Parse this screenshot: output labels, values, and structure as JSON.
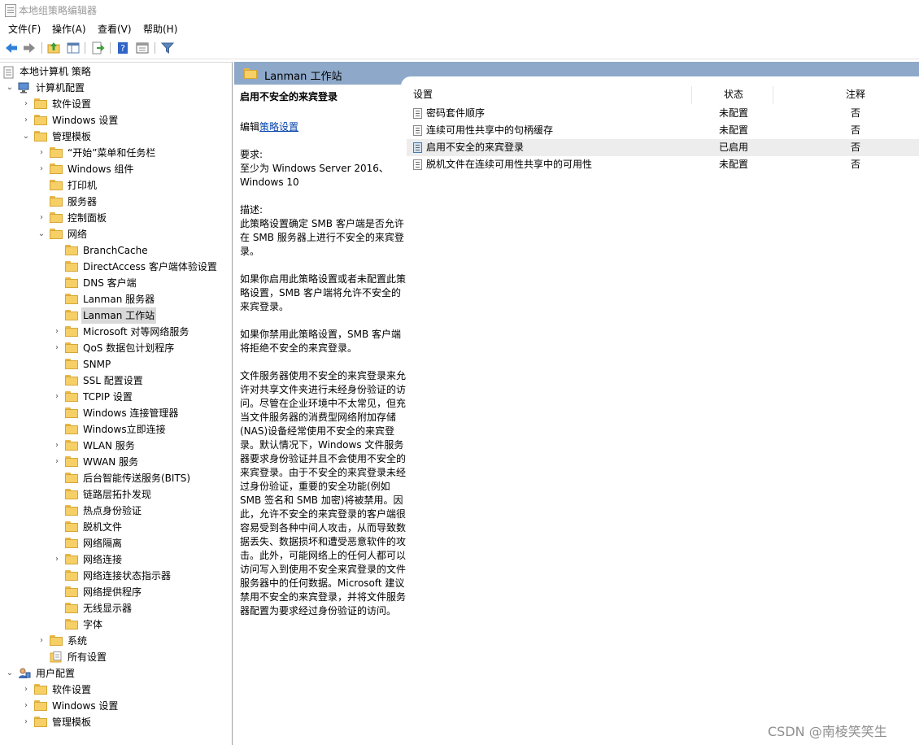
{
  "window": {
    "title": "本地组策略编辑器"
  },
  "menu": {
    "file": "文件(F)",
    "action": "操作(A)",
    "view": "查看(V)",
    "help": "帮助(H)"
  },
  "toolbar_icons": [
    "back-arrow-icon",
    "forward-arrow-icon",
    "up-folder-icon",
    "show-hide-tree-icon",
    "export-list-icon",
    "help-icon",
    "properties-icon",
    "filter-icon"
  ],
  "tree": {
    "root": "本地计算机 策略",
    "computer_config": "计算机配置",
    "software_settings": "软件设置",
    "windows_settings": "Windows 设置",
    "admin_templates": "管理模板",
    "start_menu": "“开始”菜单和任务栏",
    "windows_components": "Windows 组件",
    "printers": "打印机",
    "server": "服务器",
    "control_panel": "控制面板",
    "network": "网络",
    "network_items": [
      "BranchCache",
      "DirectAccess 客户端体验设置",
      "DNS 客户端",
      "Lanman 服务器",
      "Lanman 工作站",
      "Microsoft 对等网络服务",
      "QoS 数据包计划程序",
      "SNMP",
      "SSL 配置设置",
      "TCPIP 设置",
      "Windows 连接管理器",
      "Windows立即连接",
      "WLAN 服务",
      "WWAN 服务",
      "后台智能传送服务(BITS)",
      "链路层拓扑发现",
      "热点身份验证",
      "脱机文件",
      "网络隔离",
      "网络连接",
      "网络连接状态指示器",
      "网络提供程序",
      "无线显示器",
      "字体"
    ],
    "system": "系统",
    "all_settings": "所有设置",
    "user_config": "用户配置",
    "user_software_settings": "软件设置",
    "user_windows_settings": "Windows 设置",
    "user_admin_templates": "管理模板"
  },
  "pane": {
    "header_title": "Lanman 工作站",
    "description": {
      "policy_title": "启用不安全的来宾登录",
      "edit_prefix": "编辑",
      "edit_link": "策略设置",
      "requirements_label": "要求:",
      "requirements_text": "至少为 Windows Server 2016、Windows 10",
      "description_label": "描述:",
      "para1": "此策略设置确定 SMB 客户端是否允许在 SMB 服务器上进行不安全的来宾登录。",
      "para2": "如果你启用此策略设置或者未配置此策略设置，SMB 客户端将允许不安全的来宾登录。",
      "para3": "如果你禁用此策略设置，SMB 客户端将拒绝不安全的来宾登录。",
      "para4": "文件服务器使用不安全的来宾登录来允许对共享文件夹进行未经身份验证的访问。尽管在企业环境中不太常见，但充当文件服务器的消费型网络附加存储(NAS)设备经常使用不安全的来宾登录。默认情况下，Windows 文件服务器要求身份验证并且不会使用不安全的来宾登录。由于不安全的来宾登录未经过身份验证，重要的安全功能(例如 SMB 签名和 SMB 加密)将被禁用。因此，允许不安全的来宾登录的客户端很容易受到各种中间人攻击，从而导致数据丢失、数据损坏和遭受恶意软件的攻击。此外，可能网络上的任何人都可以访问写入到使用不安全来宾登录的文件服务器中的任何数据。Microsoft 建议禁用不安全的来宾登录，并将文件服务器配置为要求经过身份验证的访问。"
    },
    "columns": {
      "setting": "设置",
      "state": "状态",
      "comment": "注释"
    },
    "rows": [
      {
        "name": "密码套件顺序",
        "state": "未配置",
        "comment": "否"
      },
      {
        "name": "连续可用性共享中的句柄缓存",
        "state": "未配置",
        "comment": "否"
      },
      {
        "name": "启用不安全的来宾登录",
        "state": "已启用",
        "comment": "否"
      },
      {
        "name": "脱机文件在连续可用性共享中的可用性",
        "state": "未配置",
        "comment": "否"
      }
    ]
  },
  "watermark": "CSDN @南棱笑笑生",
  "colors": {
    "pane_header": "#8da8c9",
    "folder": "#f6cf66",
    "selected": "#d9d9d9",
    "link": "#0645ad"
  }
}
